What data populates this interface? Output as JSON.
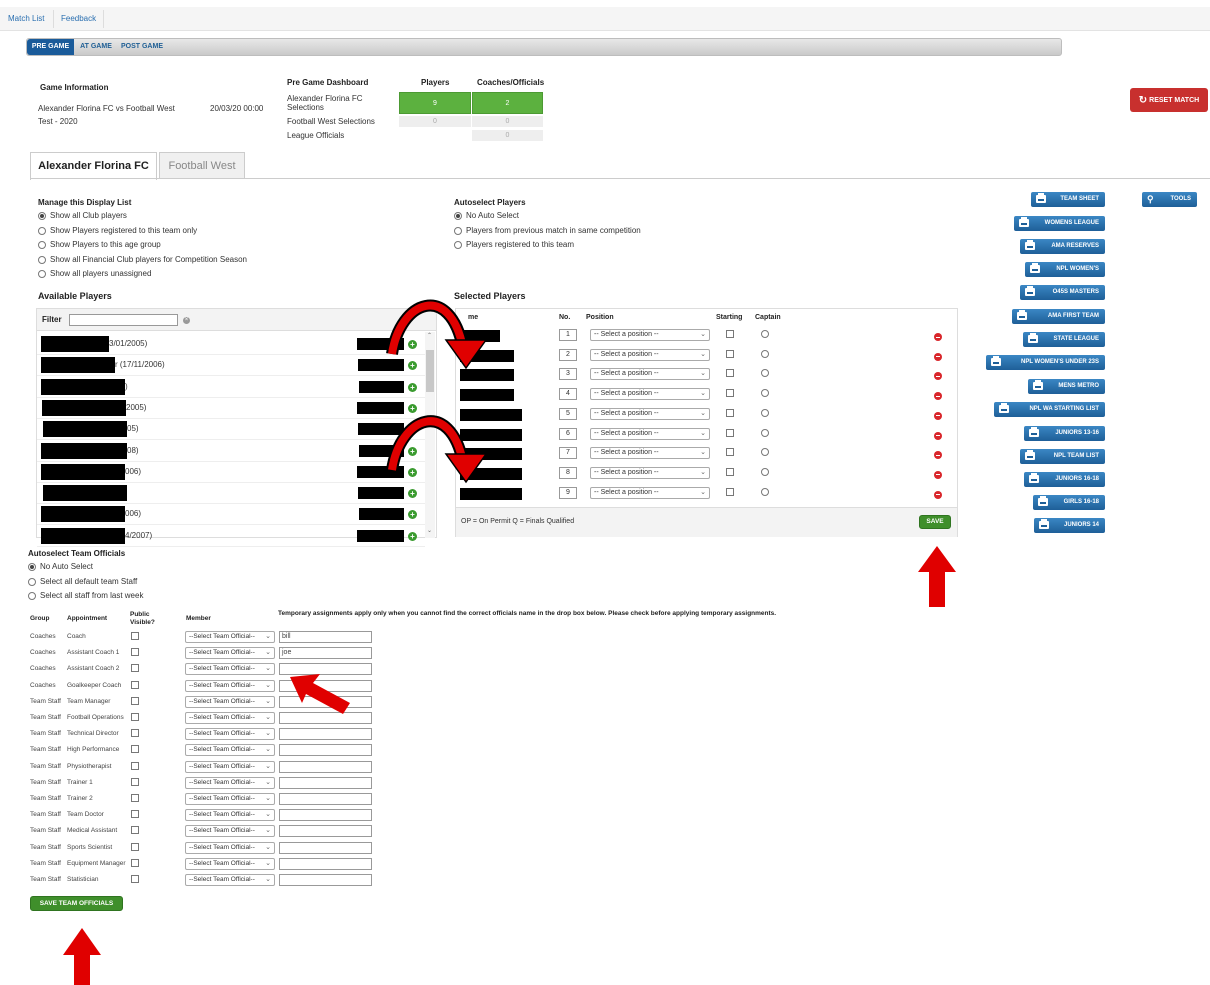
{
  "nav": {
    "match_list": "Match List",
    "feedback": "Feedback"
  },
  "tabs": [
    {
      "label": "PRE GAME"
    },
    {
      "label": "AT GAME"
    },
    {
      "label": "POST GAME"
    }
  ],
  "game_info": {
    "heading": "Game Information",
    "match": "Alexander Florina FC vs Football West",
    "datetime": "20/03/20 00:00",
    "competition": "Test - 2020"
  },
  "dashboard": {
    "heading": "Pre Game Dashboard",
    "col_players": "Players",
    "col_coaches": "Coaches/Officials",
    "rows": [
      {
        "label": "Alexander Florina FC Selections",
        "players": "9",
        "coaches": "2"
      },
      {
        "label": "Football West Selections",
        "players": "0",
        "coaches": "0"
      },
      {
        "label": "League Officials",
        "coaches": "0"
      }
    ]
  },
  "reset_label": "RESET MATCH",
  "club_tabs": [
    {
      "label": "Alexander Florina FC"
    },
    {
      "label": "Football West"
    }
  ],
  "display_list": {
    "heading": "Manage this Display List",
    "options": [
      "Show all Club players",
      "Show Players registered to this team only",
      "Show Players to this age group",
      "Show all Financial Club players for Competition Season",
      "Show all players unassigned"
    ]
  },
  "autoselect_players": {
    "heading": "Autoselect Players",
    "options": [
      "No Auto Select",
      "Players from previous match in same competition",
      "Players registered to this team"
    ]
  },
  "available": {
    "heading": "Available Players",
    "filter_label": "Filter",
    "rows": [
      {
        "suffix": "3/01/2005)"
      },
      {
        "suffix": "r (17/11/2006)"
      },
      {
        "suffix": ")"
      },
      {
        "suffix": "2005)"
      },
      {
        "suffix": "05)"
      },
      {
        "suffix": "08)"
      },
      {
        "suffix": "006)"
      },
      {
        "suffix": ""
      },
      {
        "suffix": "006)"
      },
      {
        "suffix": "4/2007)"
      }
    ]
  },
  "selected": {
    "heading": "Selected Players",
    "col_name": "me",
    "col_no": "No.",
    "col_position": "Position",
    "col_starting": "Starting",
    "col_captain": "Captain",
    "position_placeholder": "-- Select a position --",
    "numbers": [
      "1",
      "2",
      "3",
      "4",
      "5",
      "6",
      "7",
      "8",
      "9"
    ],
    "footer": "OP = On Permit  Q = Finals Qualified",
    "save_label": "SAVE"
  },
  "side_buttons": [
    "TEAM SHEET",
    "WOMENS LEAGUE",
    "AMA RESERVES",
    "NPL WOMEN'S",
    "O45S MASTERS",
    "AMA FIRST TEAM",
    "STATE LEAGUE",
    "NPL WOMEN'S UNDER 23S",
    "MENS METRO",
    "NPL WA STARTING LIST",
    "JUNIORS 13-16",
    "NPL TEAM LIST",
    "JUNIORS 16-18",
    "GIRLS 16-18",
    "JUNIORS 14"
  ],
  "tools_label": "TOOLS",
  "autoselect_officials": {
    "heading": "Autoselect Team Officials",
    "options": [
      "No Auto Select",
      "Select all default team Staff",
      "Select all staff from last week"
    ]
  },
  "officials": {
    "col_group": "Group",
    "col_appointment": "Appointment",
    "col_public": "Public Visible?",
    "col_member": "Member",
    "temp_note": "Temporary assignments apply only when you cannot find the correct officials name in the drop box below. Please check before applying temporary assignments.",
    "member_placeholder": "--Select Team Official--",
    "rows": [
      {
        "group": "Coaches",
        "appointment": "Coach",
        "temp": "bill"
      },
      {
        "group": "Coaches",
        "appointment": "Assistant Coach 1",
        "temp": "joe"
      },
      {
        "group": "Coaches",
        "appointment": "Assistant Coach 2",
        "temp": ""
      },
      {
        "group": "Coaches",
        "appointment": "Goalkeeper Coach",
        "temp": ""
      },
      {
        "group": "Team Staff",
        "appointment": "Team Manager",
        "temp": ""
      },
      {
        "group": "Team Staff",
        "appointment": "Football Operations",
        "temp": ""
      },
      {
        "group": "Team Staff",
        "appointment": "Technical Director",
        "temp": ""
      },
      {
        "group": "Team Staff",
        "appointment": "High Performance",
        "temp": ""
      },
      {
        "group": "Team Staff",
        "appointment": "Physiotherapist",
        "temp": ""
      },
      {
        "group": "Team Staff",
        "appointment": "Trainer 1",
        "temp": ""
      },
      {
        "group": "Team Staff",
        "appointment": "Trainer 2",
        "temp": ""
      },
      {
        "group": "Team Staff",
        "appointment": "Team Doctor",
        "temp": ""
      },
      {
        "group": "Team Staff",
        "appointment": "Medical Assistant",
        "temp": ""
      },
      {
        "group": "Team Staff",
        "appointment": "Sports Scientist",
        "temp": ""
      },
      {
        "group": "Team Staff",
        "appointment": "Equipment Manager",
        "temp": ""
      },
      {
        "group": "Team Staff",
        "appointment": "Statistician",
        "temp": ""
      }
    ],
    "save_label": "SAVE TEAM OFFICIALS"
  },
  "colors": {
    "accent": "#1a5b9a",
    "green": "#3f8f2b",
    "red": "#c8302e",
    "annotation": "#e00000"
  }
}
